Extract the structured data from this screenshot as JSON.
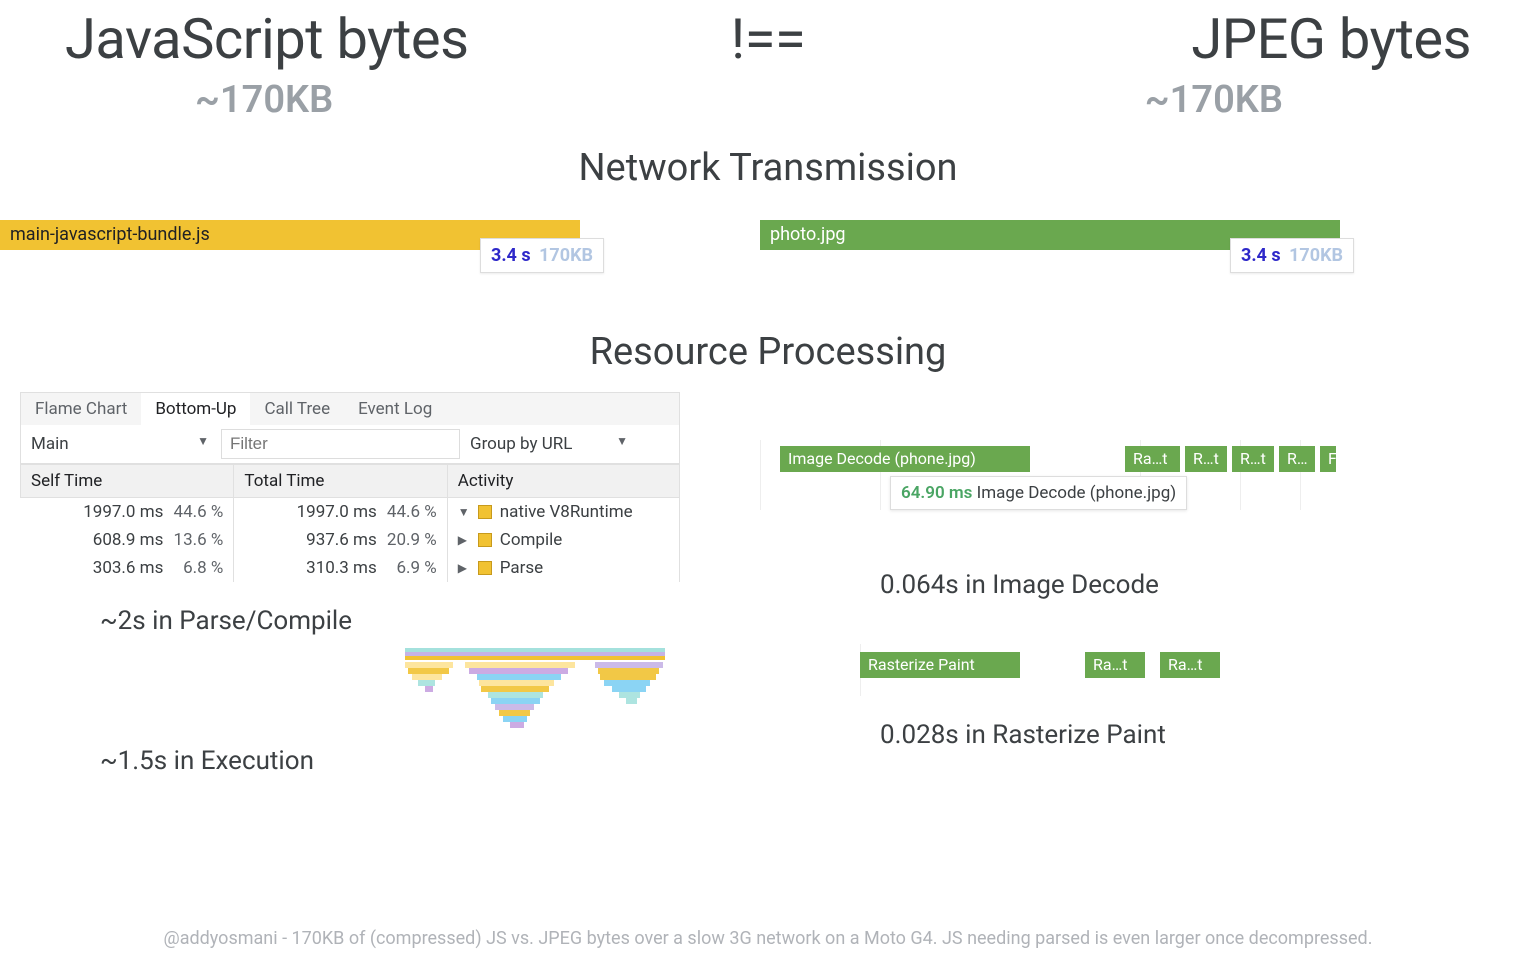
{
  "top": {
    "left": "JavaScript bytes",
    "op": "!==",
    "right": "JPEG bytes",
    "size_left": "~170KB",
    "size_right": "~170KB"
  },
  "sections": {
    "network": "Network Transmission",
    "processing": "Resource Processing"
  },
  "bars": {
    "js_name": "main-javascript-bundle.js",
    "jpg_name": "photo.jpg",
    "js_badge_time": "3.4 s",
    "js_badge_size": "170KB",
    "jpg_badge_time": "3.4 s",
    "jpg_badge_size": "170KB"
  },
  "tabs": [
    "Flame Chart",
    "Bottom-Up",
    "Call Tree",
    "Event Log"
  ],
  "filterbar": {
    "thread": "Main",
    "filter_placeholder": "Filter",
    "group": "Group by URL"
  },
  "table": {
    "headers": [
      "Self Time",
      "Total Time",
      "Activity"
    ],
    "rows": [
      {
        "self_ms": "1997.0 ms",
        "self_pct": "44.6 %",
        "self_bar_pct": 44.6,
        "total_ms": "1997.0 ms",
        "total_pct": "44.6 %",
        "total_bar_pct": 44.6,
        "activity": "native V8Runtime",
        "tri": "▼"
      },
      {
        "self_ms": "608.9 ms",
        "self_pct": "13.6 %",
        "self_bar_pct": 13.6,
        "total_ms": "937.6 ms",
        "total_pct": "20.9 %",
        "total_bar_pct": 20.9,
        "activity": "Compile",
        "tri": "▶"
      },
      {
        "self_ms": "303.6 ms",
        "self_pct": "6.8 %",
        "self_bar_pct": 6.8,
        "total_ms": "310.3 ms",
        "total_pct": "6.9 %",
        "total_bar_pct": 6.9,
        "activity": "Parse",
        "tri": "▶"
      }
    ]
  },
  "left_summaries": {
    "parse": "~2s in Parse/Compile",
    "exec": "~1.5s in Execution"
  },
  "timeline": {
    "main_event": "Image Decode (phone.jpg)",
    "small_events": [
      "Ra…t",
      "R…t",
      "R…t",
      "R…",
      "F"
    ],
    "tooltip_ms": "64.90 ms",
    "tooltip_label": "Image Decode (phone.jpg)",
    "paint_events": [
      "Rasterize Paint",
      "Ra…t",
      "Ra…t"
    ]
  },
  "right_summaries": {
    "decode": "0.064s in Image Decode",
    "paint": "0.028s in Rasterize Paint"
  },
  "footer": "@addyosmani - 170KB of (compressed) JS vs. JPEG bytes over a slow 3G network on a Moto G4. JS needing parsed is even larger once decompressed."
}
